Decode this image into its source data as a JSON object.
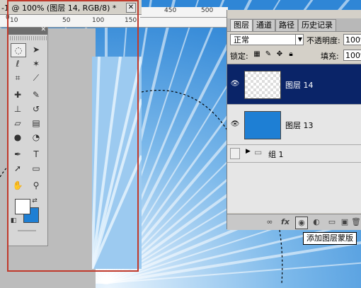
{
  "document": {
    "tab_title": "-1 @ 100% (图层 14, RGB/8) *",
    "close_glyph": "✕"
  },
  "ruler": {
    "top_ticks": [
      "0",
      "10",
      "50",
      "100",
      "150"
    ],
    "right_ticks": [
      "450",
      "500"
    ]
  },
  "toolbox": {
    "close_glyph": "✕"
  },
  "panel": {
    "tabs": [
      "图层",
      "通道",
      "路径",
      "历史记录"
    ],
    "blend_mode": "正常",
    "opacity_label": "不透明度:",
    "opacity_value": "100%",
    "lock_label": "锁定:",
    "fill_label": "填充:",
    "fill_value": "100%",
    "layers": [
      {
        "name": "图层 14",
        "selected": true,
        "visible": true
      },
      {
        "name": "图层 13",
        "selected": false,
        "visible": true
      },
      {
        "name": "组 1",
        "selected": false,
        "visible": false,
        "type": "group"
      }
    ],
    "tooltip": "添加图层蒙版"
  },
  "colors": {
    "selection": "#0a2468",
    "foreground": "#ffffff",
    "background": "#1e7fd4",
    "frame": "#c0392b"
  }
}
